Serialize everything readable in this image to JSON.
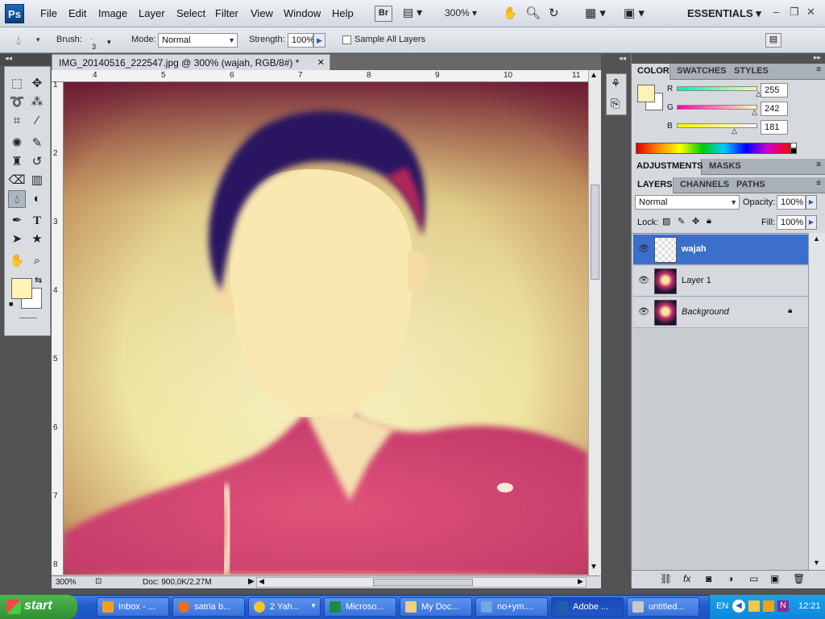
{
  "app": {
    "logo": "Ps",
    "menu": [
      "File",
      "Edit",
      "Image",
      "Layer",
      "Select",
      "Filter",
      "View",
      "Window",
      "Help"
    ],
    "bridge": "Br",
    "zoom": "300%",
    "workspace": "ESSENTIALS"
  },
  "options": {
    "brush_label": "Brush:",
    "brush_size": "3",
    "mode_label": "Mode:",
    "mode_value": "Normal",
    "strength_label": "Strength:",
    "strength_value": "100%",
    "sample_all_label": "Sample All Layers"
  },
  "document": {
    "tab_title": "IMG_20140516_222547.jpg @ 300% (wajah, RGB/8#) *",
    "ruler_h": [
      "4",
      "5",
      "6",
      "7",
      "8",
      "9",
      "10",
      "11"
    ],
    "ruler_v": [
      "1",
      "2",
      "3",
      "4",
      "5",
      "6",
      "7",
      "8"
    ],
    "status_zoom": "300%",
    "status_doc": "Doc: 900,0K/2,27M"
  },
  "color_panel": {
    "tabs": [
      "COLOR",
      "SWATCHES",
      "STYLES"
    ],
    "r_label": "R",
    "r_value": "255",
    "r": 255,
    "g_label": "G",
    "g_value": "242",
    "g": 242,
    "b_label": "B",
    "b_value": "181",
    "b": 181,
    "foreground": "#fff2b5"
  },
  "adjust_panel": {
    "tabs": [
      "ADJUSTMENTS",
      "MASKS"
    ]
  },
  "layers_panel": {
    "tabs": [
      "LAYERS",
      "CHANNELS",
      "PATHS"
    ],
    "blend_mode": "Normal",
    "opacity_label": "Opacity:",
    "opacity_value": "100%",
    "lock_label": "Lock:",
    "fill_label": "Fill:",
    "fill_value": "100%",
    "layers": [
      {
        "name": "wajah",
        "selected": true
      },
      {
        "name": "Layer 1",
        "selected": false
      },
      {
        "name": "Background",
        "selected": false,
        "italic": true,
        "locked": true
      }
    ]
  },
  "taskbar": {
    "start": "start",
    "items": [
      {
        "label": "Inbox - ...",
        "color": "#f1a21a"
      },
      {
        "label": "satria b...",
        "color": "#e8701c"
      },
      {
        "label": "2 Yah...",
        "color": "#f2c52e"
      },
      {
        "label": "Microso...",
        "color": "#1e8a3d"
      },
      {
        "label": "My Doc...",
        "color": "#e9d27a"
      },
      {
        "label": "no+ym....",
        "color": "#6fa6e8"
      },
      {
        "label": "Adobe ...",
        "color": "#1c5fa8"
      },
      {
        "label": "untitled...",
        "color": "#c9c9c9"
      }
    ],
    "lang": "EN",
    "clock": "12:21"
  }
}
